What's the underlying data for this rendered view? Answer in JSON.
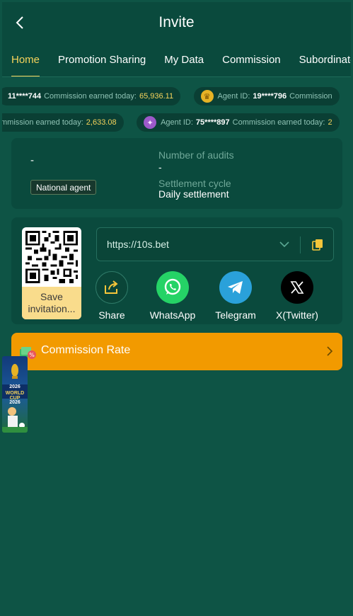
{
  "header": {
    "title": "Invite"
  },
  "tabs": [
    {
      "label": "Home",
      "active": true
    },
    {
      "label": "Promotion Sharing",
      "active": false
    },
    {
      "label": "My Data",
      "active": false
    },
    {
      "label": "Commission",
      "active": false
    },
    {
      "label": "Subordinate I",
      "active": false
    }
  ],
  "ticker": {
    "row1": [
      {
        "prefix": "",
        "id": "11****744",
        "label": "Commission earned today:",
        "amount": "65,936.11",
        "medal": ""
      },
      {
        "prefix": "Agent ID:",
        "id": "19****796",
        "label": "Commission",
        "amount": "",
        "medal": "gold-medal"
      }
    ],
    "row2": [
      {
        "prefix": "",
        "id": "",
        "label": "mmission earned today:",
        "amount": "2,633.08",
        "medal": ""
      },
      {
        "prefix": "Agent ID:",
        "id": "75****897",
        "label": "Commission earned today:",
        "amount": "2",
        "medal": "purple-medal"
      }
    ]
  },
  "agent": {
    "name": "-",
    "badge": "National agent",
    "audits_label": "Number of audits",
    "audits_value": "-",
    "settlement_label": "Settlement cycle",
    "settlement_value": "Daily settlement"
  },
  "invite": {
    "save_label": "Save invitation...",
    "link": "https://10s.bet",
    "share": [
      {
        "label": "Share",
        "icon": "share-icon"
      },
      {
        "label": "WhatsApp",
        "icon": "whatsapp-icon"
      },
      {
        "label": "Telegram",
        "icon": "telegram-icon"
      },
      {
        "label": "X(Twitter)",
        "icon": "x-twitter-icon"
      }
    ]
  },
  "commission_rate": {
    "label": "Commission Rate"
  },
  "float_banner": {
    "year1": "2026",
    "title": "WORLD CUP",
    "year2": "2026"
  },
  "colors": {
    "background": "#0e5445",
    "card": "#0a4a3d",
    "accent_yellow": "#f5d35b",
    "commission_orange": "#f29a00",
    "whatsapp_green": "#25d366",
    "telegram_blue": "#2aa1da"
  }
}
